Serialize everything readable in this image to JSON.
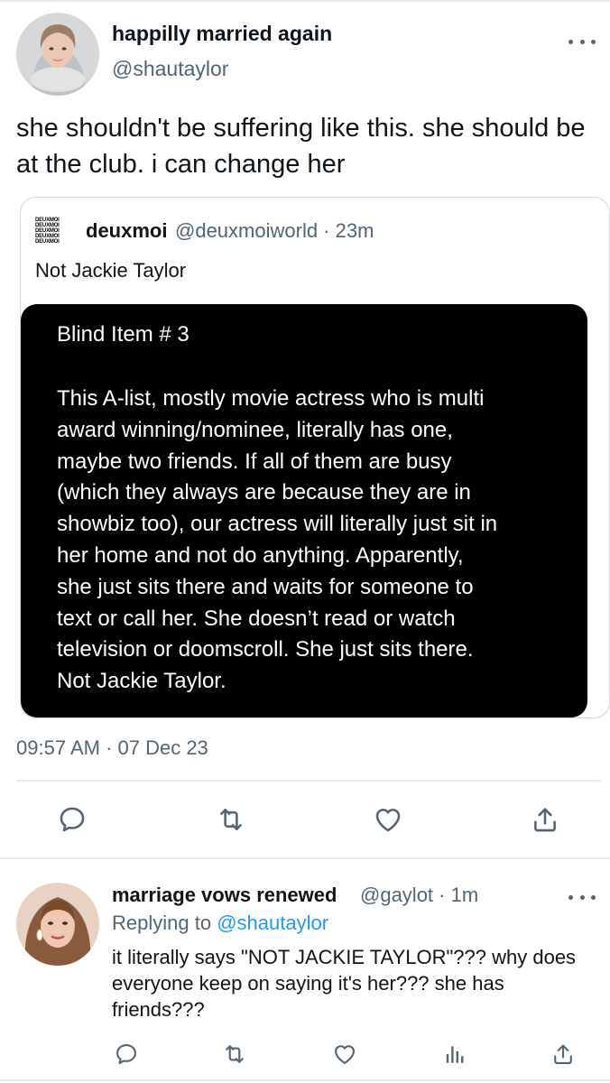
{
  "main_tweet": {
    "display_name": "happilly married again",
    "handle": "@shautaylor",
    "text": "she shouldn't be suffering like this. she should be at the club. i can change her",
    "timestamp": "09:57 AM · 07 Dec 23"
  },
  "quoted_tweet": {
    "logo_lines": [
      "DEUXMOI",
      "DEUXMOI",
      "DEUXMOI",
      "DEUXMOI",
      "DEUXMOI"
    ],
    "display_name": "deuxmoi",
    "handle_time": "@deuxmoiworld · 23m",
    "text": "Not Jackie Taylor",
    "image": {
      "title": "Blind Item # 3",
      "lines": [
        "This A-list, mostly movie actress who is multi",
        "award winning/nominee, literally has one,",
        "maybe two friends. If all of them are busy",
        "(which they always are because they are in",
        "showbiz too), our actress will literally just sit in",
        "her home and not do anything. Apparently,",
        "she just sits there and waits for someone to",
        "text or call her. She doesn’t read or watch",
        "television or doomscroll. She just sits there.",
        "Not Jackie Taylor."
      ]
    }
  },
  "actions": {
    "icons": [
      "reply-icon",
      "retweet-icon",
      "like-icon",
      "share-icon"
    ]
  },
  "reply_tweet": {
    "display_name": "marriage vows renewed",
    "handle_time": "@gaylot · 1m",
    "replying_label": "Replying to",
    "replying_mention": "@shautaylor",
    "text": "it literally says \"NOT JACKIE TAYLOR\"??? why does everyone keep on saying it's her??? she has friends???",
    "icons": [
      "reply-icon",
      "retweet-icon",
      "like-icon",
      "analytics-icon",
      "share-icon"
    ]
  },
  "colors": {
    "text": "#0f1419",
    "secondary": "#536471",
    "link": "#1d9bf0",
    "border": "#e6ecf0"
  }
}
